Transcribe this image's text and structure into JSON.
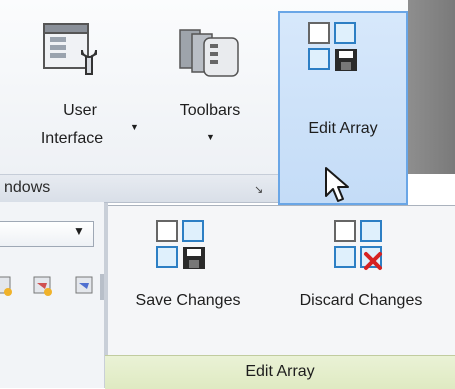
{
  "ribbon": {
    "buttons": {
      "user_interface": {
        "line1": "User",
        "line2": "Interface"
      },
      "toolbars": {
        "label": "Toolbars"
      },
      "edit_array": {
        "label": "Edit Array"
      }
    },
    "panel_title": "ndows"
  },
  "dropdown": {
    "save_changes": "Save Changes",
    "discard_changes": "Discard Changes",
    "footer_title": "Edit Array"
  },
  "icons": {
    "user_interface": "window-wrench-icon",
    "toolbars": "toolbar-stack-icon",
    "edit_array": "array-save-icon",
    "save_changes": "array-save-icon",
    "discard_changes": "array-discard-icon",
    "cursor": "mouse-pointer-icon"
  },
  "colors": {
    "highlight_fill": "#c4dcf7",
    "highlight_border": "#6aa6e6",
    "footer_green": "#dfeac2"
  }
}
